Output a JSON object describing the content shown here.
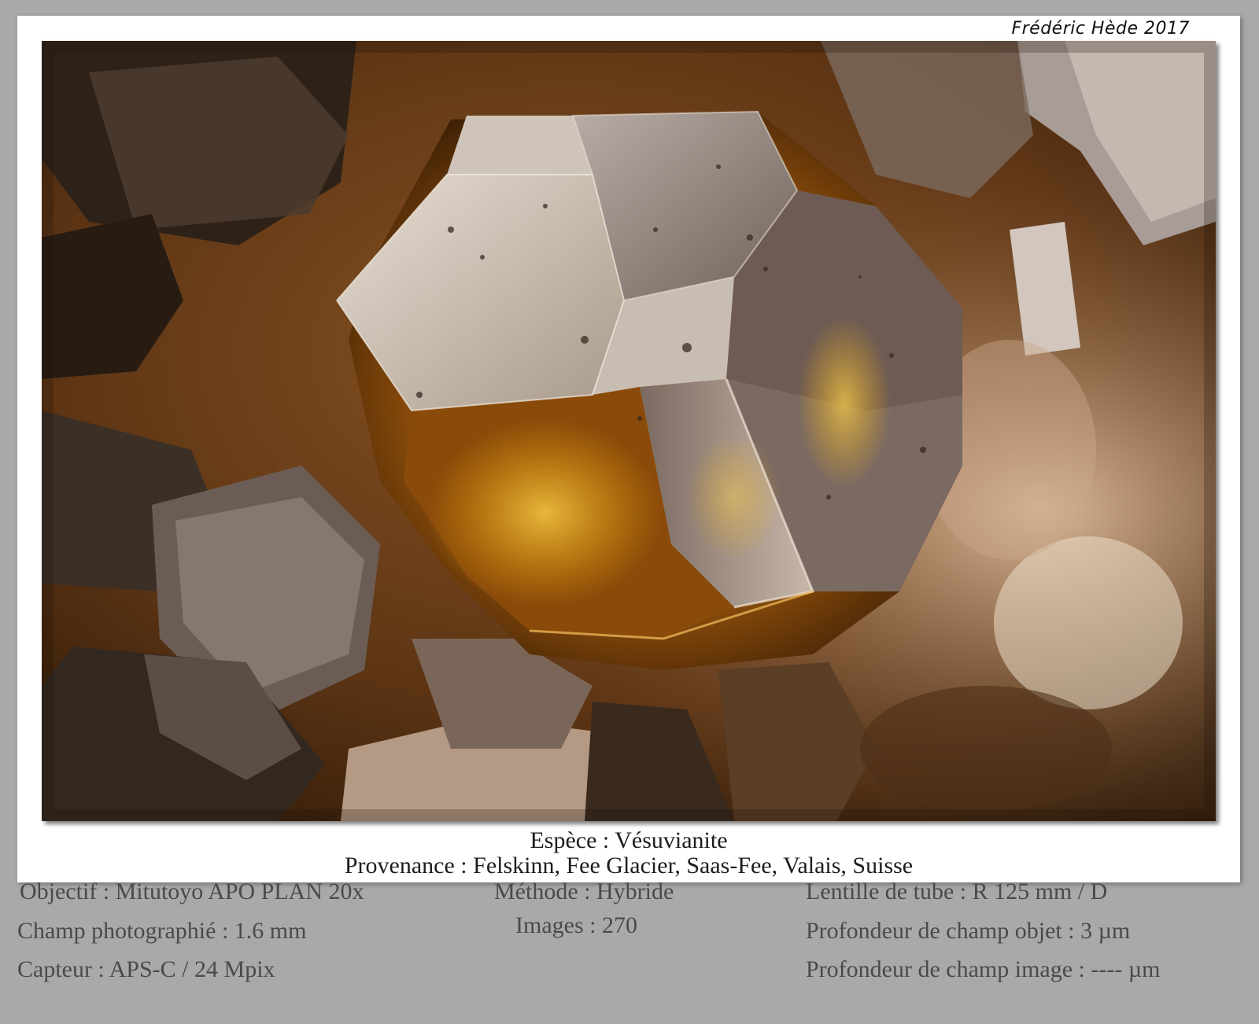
{
  "credit": "Frédéric Hède 2017",
  "caption": {
    "species": "Espèce : Vésuvianite",
    "origin": "Provenance : Felskinn, Fee Glacier, Saas-Fee, Valais, Suisse"
  },
  "specs": {
    "objective": "Objectif : Mitutoyo APO PLAN 20x",
    "field": "Champ photographié : 1.6 mm",
    "sensor": "Capteur : APS-C / 24 Mpix",
    "method": "Méthode : Hybride",
    "images": "Images : 270",
    "tube_lens": "Lentille de tube : R 125 mm / D",
    "object_dof": "Profondeur de champ objet : 3 µm",
    "image_dof": "Profondeur de champ image : ---- µm"
  }
}
